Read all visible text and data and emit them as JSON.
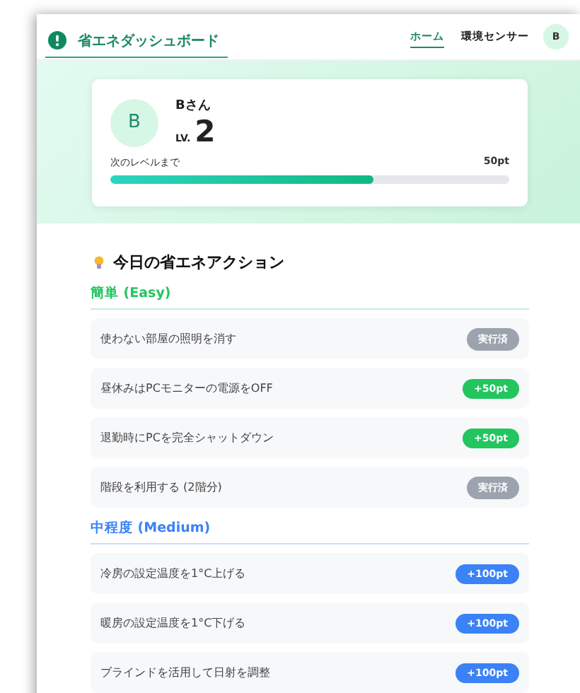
{
  "header": {
    "title": "省エネダッシュボード",
    "nav": [
      {
        "label": "ホーム",
        "selected": true
      },
      {
        "label": "環境センサー",
        "selected": false
      }
    ],
    "avatar": "B"
  },
  "profile": {
    "avatar": "B",
    "name": "Bさん",
    "level_prefix": "LV.",
    "level": "2",
    "progress_label": "次のレベルまで",
    "progress_value": "50pt",
    "progress": {
      "level": 0.66
    }
  },
  "actions_title": "今日の省エネアクション",
  "categories": [
    {
      "title": "簡単 (Easy)",
      "color": "#22c55e",
      "actions": [
        {
          "text": "使わない部屋の照明を消す",
          "badge": "実行済",
          "done": true
        },
        {
          "text": "昼休みはPCモニターの電源をOFF",
          "badge": "+50pt",
          "done": false
        },
        {
          "text": "退勤時にPCを完全シャットダウン",
          "badge": "+50pt",
          "done": false
        },
        {
          "text": "階段を利用する (2階分)",
          "badge": "実行済",
          "done": true
        }
      ]
    },
    {
      "title": "中程度 (Medium)",
      "color": "#3b82f6",
      "actions": [
        {
          "text": "冷房の設定温度を1°C上げる",
          "badge": "+100pt",
          "done": false
        },
        {
          "text": "暖房の設定温度を1°C下げる",
          "badge": "+100pt",
          "done": false
        },
        {
          "text": "ブラインドを活用して日射を調整",
          "badge": "+100pt",
          "done": false
        }
      ]
    }
  ]
}
